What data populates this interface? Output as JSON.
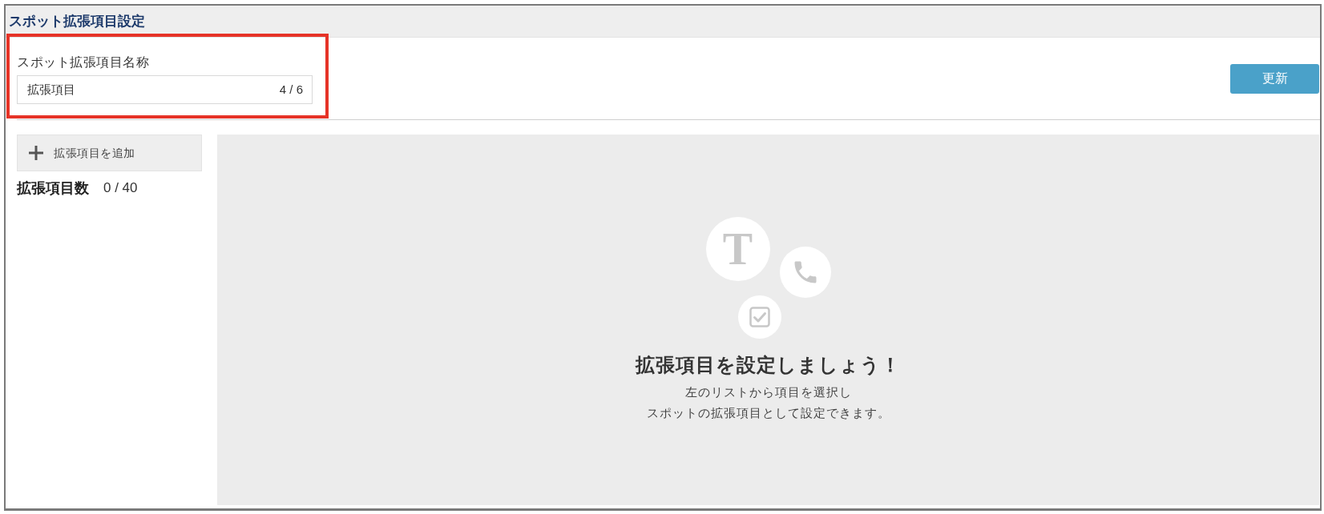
{
  "header": {
    "title": "スポット拡張項目設定"
  },
  "name_field": {
    "label": "スポット拡張項目名称",
    "value": "拡張項目",
    "counter": "4 / 6",
    "highlighted": true
  },
  "update_button": {
    "label": "更新"
  },
  "add_button": {
    "label": "拡張項目を追加"
  },
  "item_count": {
    "label": "拡張項目数",
    "value": "0 / 40"
  },
  "empty_state": {
    "icons": [
      {
        "kind": "letter",
        "glyph": "T"
      },
      {
        "kind": "phone"
      },
      {
        "kind": "checkbox"
      }
    ],
    "heading": "拡張項目を設定しましょう！",
    "description_lines": [
      "左のリストから項目を選択し",
      "スポットの拡張項目として設定できます。"
    ]
  }
}
